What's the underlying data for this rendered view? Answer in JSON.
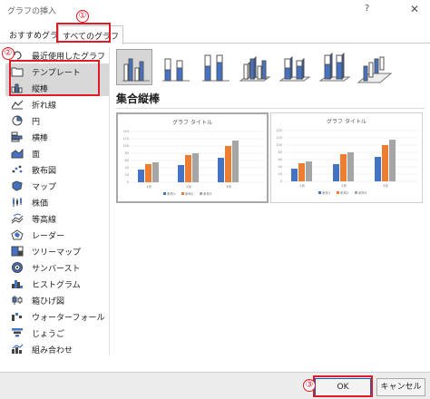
{
  "window": {
    "title": "グラフの挿入",
    "help_glyph": "?",
    "close_glyph": "✕"
  },
  "tabs": [
    {
      "label": "おすすめグラフ"
    },
    {
      "label": "すべてのグラフ"
    }
  ],
  "callouts": [
    "①",
    "②",
    "③"
  ],
  "sidebar": {
    "items": [
      {
        "label": "最近使用したグラフ",
        "icon": "recent-icon"
      },
      {
        "label": "テンプレート",
        "icon": "template-folder-icon"
      },
      {
        "label": "縦棒",
        "icon": "column-chart-icon"
      },
      {
        "label": "折れ線",
        "icon": "line-chart-icon"
      },
      {
        "label": "円",
        "icon": "pie-chart-icon"
      },
      {
        "label": "横棒",
        "icon": "bar-chart-icon"
      },
      {
        "label": "面",
        "icon": "area-chart-icon"
      },
      {
        "label": "散布図",
        "icon": "scatter-chart-icon"
      },
      {
        "label": "マップ",
        "icon": "map-chart-icon"
      },
      {
        "label": "株価",
        "icon": "stock-chart-icon"
      },
      {
        "label": "等高線",
        "icon": "surface-chart-icon"
      },
      {
        "label": "レーダー",
        "icon": "radar-chart-icon"
      },
      {
        "label": "ツリーマップ",
        "icon": "treemap-icon"
      },
      {
        "label": "サンバースト",
        "icon": "sunburst-icon"
      },
      {
        "label": "ヒストグラム",
        "icon": "histogram-icon"
      },
      {
        "label": "箱ひげ図",
        "icon": "box-whisker-icon"
      },
      {
        "label": "ウォーターフォール",
        "icon": "waterfall-icon"
      },
      {
        "label": "じょうご",
        "icon": "funnel-icon"
      },
      {
        "label": "組み合わせ",
        "icon": "combo-chart-icon"
      }
    ]
  },
  "subtypes": [
    "clustered-column-icon",
    "stacked-column-icon",
    "percent-stacked-column-icon",
    "3d-clustered-column-icon",
    "3d-stacked-column-icon",
    "3d-percent-stacked-column-icon",
    "3d-column-icon"
  ],
  "main": {
    "heading": "集合縦棒"
  },
  "previews": [
    {
      "title": "グラフ タイトル",
      "yticks": [
        "140",
        "120",
        "100",
        "80",
        "60",
        "40",
        "20",
        "0"
      ],
      "categories": [
        "1月",
        "2月",
        "3月"
      ],
      "legend": [
        "系列1",
        "系列2",
        "系列3"
      ]
    },
    {
      "title": "グラフ タイトル",
      "yticks": [
        "140",
        "120",
        "100",
        "80",
        "60",
        "40",
        "20",
        "0"
      ],
      "categories": [
        "1月",
        "2月",
        "3月"
      ],
      "legend": [
        "系列1",
        "系列2",
        "系列3"
      ]
    }
  ],
  "colors": {
    "series1": "#4472c4",
    "series2": "#ed7d31",
    "series3": "#a5a5a5",
    "callout": "#e01b24"
  },
  "footer": {
    "ok_label": "OK",
    "cancel_label": "キャンセル"
  }
}
